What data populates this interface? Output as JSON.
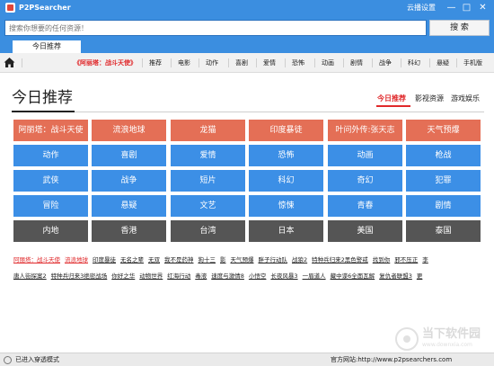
{
  "window": {
    "title": "P2PSearcher",
    "cloud_settings": "云播设置",
    "min_glyph": "—",
    "max_glyph": "□",
    "close_glyph": "✕"
  },
  "search": {
    "placeholder": "搜索你想要的任何资源！",
    "button": "搜 索"
  },
  "tabs": {
    "today": "今日推荐"
  },
  "nav": {
    "items": [
      {
        "label": "《阿丽塔：战斗天使》",
        "highlight": true
      },
      {
        "label": "推荐"
      },
      {
        "label": "电影"
      },
      {
        "label": "动作"
      },
      {
        "label": "喜剧"
      },
      {
        "label": "爱情"
      },
      {
        "label": "恐怖"
      },
      {
        "label": "动画"
      },
      {
        "label": "剧情"
      },
      {
        "label": "战争"
      },
      {
        "label": "科幻"
      },
      {
        "label": "悬疑"
      },
      {
        "label": "手机版"
      }
    ]
  },
  "section": {
    "title": "今日推荐",
    "tabs": [
      "今日推荐",
      "影视资源",
      "游戏娱乐"
    ]
  },
  "grid": {
    "rows": [
      [
        "阿丽塔：战斗天使",
        "流浪地球",
        "龙猫",
        "印度暴徒",
        "叶问外传:张天志",
        "天气预爆"
      ],
      [
        "动作",
        "喜剧",
        "爱情",
        "恐怖",
        "动画",
        "枪战"
      ],
      [
        "武侠",
        "战争",
        "短片",
        "科幻",
        "奇幻",
        "犯罪"
      ],
      [
        "冒险",
        "悬疑",
        "文艺",
        "惊悚",
        "青春",
        "剧情"
      ],
      [
        "内地",
        "香港",
        "台湾",
        "日本",
        "美国",
        "泰国"
      ]
    ],
    "row_colors": [
      "orange",
      "blue",
      "blue",
      "blue",
      "dark"
    ]
  },
  "links": {
    "row1": [
      {
        "label": "阿丽塔：战斗天使",
        "red": true
      },
      {
        "label": "流浪地球",
        "red": true
      },
      {
        "label": "印度暴徒"
      },
      {
        "label": "无名之辈"
      },
      {
        "label": "无双"
      },
      {
        "label": "我不是药神"
      },
      {
        "label": "狗十三"
      },
      {
        "label": "影"
      },
      {
        "label": "天气预爆"
      },
      {
        "label": "胖子行动队"
      },
      {
        "label": "战狼2"
      },
      {
        "label": "特种兵归来2黑色警戒"
      },
      {
        "label": "找到你"
      },
      {
        "label": "邪不压正"
      },
      {
        "label": "李"
      }
    ],
    "row2": [
      {
        "label": "唐人街探案2"
      },
      {
        "label": "特种兵归来3绝密战场"
      },
      {
        "label": "你好之华"
      },
      {
        "label": "动物世界"
      },
      {
        "label": "红海行动"
      },
      {
        "label": "毒液"
      },
      {
        "label": "速度与激情8"
      },
      {
        "label": "小悟空"
      },
      {
        "label": "长夜风暴3"
      },
      {
        "label": "一眉道人"
      },
      {
        "label": "藏中谍6全面瓦解"
      },
      {
        "label": "复仇者联盟3"
      },
      {
        "label": "更"
      }
    ]
  },
  "status": {
    "left": "已进入穿透模式",
    "site": "官方网站:http://www.p2psearchers.com"
  },
  "watermark": {
    "text": "当下软件园",
    "sub": "www.downxia.com"
  }
}
